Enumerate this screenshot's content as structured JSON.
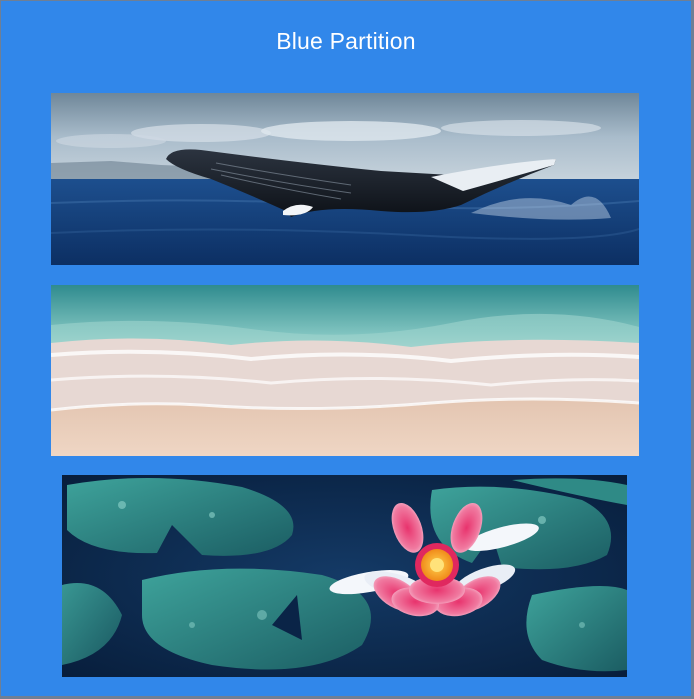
{
  "title": "Blue Partition",
  "images": [
    {
      "name": "humpback-whale-image"
    },
    {
      "name": "beach-shoreline-image"
    },
    {
      "name": "water-lily-image"
    }
  ],
  "colors": {
    "background": "#3187ea",
    "title_text": "#ffffff",
    "frame_border": "#6f7f95"
  }
}
